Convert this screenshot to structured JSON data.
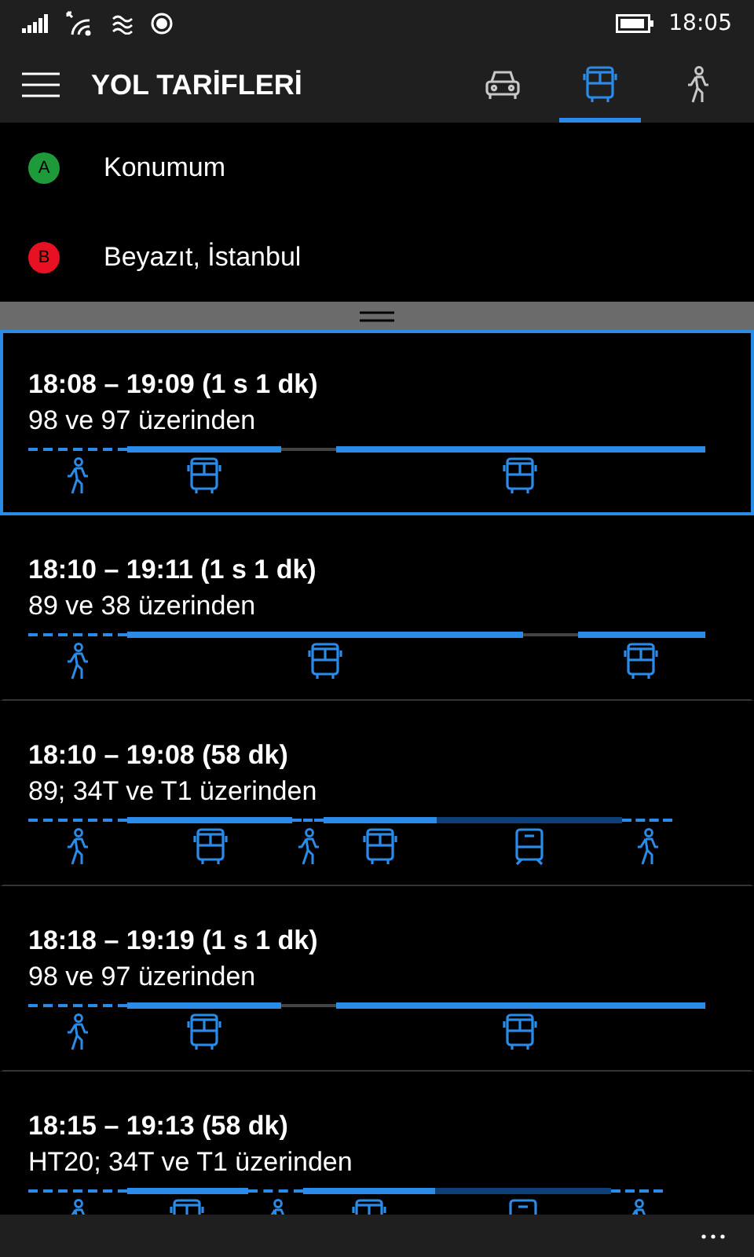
{
  "status_bar": {
    "time": "18:05"
  },
  "header": {
    "title": "YOL TARİFLERİ",
    "modes": [
      {
        "kind": "car",
        "selected": false
      },
      {
        "kind": "bus",
        "selected": true
      },
      {
        "kind": "walk",
        "selected": false
      }
    ]
  },
  "waypoints": [
    {
      "badge": "A",
      "color": "#1f9a3a",
      "label": "Konumum"
    },
    {
      "badge": "B",
      "color": "#e81123",
      "label": "Beyazıt, İstanbul"
    }
  ],
  "routes": [
    {
      "time": "18:08 – 19:09 (1 s 1 dk)",
      "via": "98 ve 97 üzerinden",
      "selected": true,
      "segments": [
        {
          "kind": "walk"
        },
        {
          "kind": "bus"
        },
        {
          "kind": "wait"
        },
        {
          "kind": "bus"
        }
      ]
    },
    {
      "time": "18:10 – 19:11 (1 s 1 dk)",
      "via": "89 ve 38 üzerinden",
      "selected": false,
      "segments": [
        {
          "kind": "walk"
        },
        {
          "kind": "bus"
        },
        {
          "kind": "wait"
        },
        {
          "kind": "bus"
        }
      ]
    },
    {
      "time": "18:10 – 19:08 (58 dk)",
      "via": "89; 34T ve T1 üzerinden",
      "selected": false,
      "segments": [
        {
          "kind": "walk"
        },
        {
          "kind": "bus"
        },
        {
          "kind": "walk"
        },
        {
          "kind": "bus"
        },
        {
          "kind": "tram"
        },
        {
          "kind": "walk"
        }
      ]
    },
    {
      "time": "18:18 – 19:19 (1 s 1 dk)",
      "via": "98 ve 97 üzerinden",
      "selected": false,
      "segments": [
        {
          "kind": "walk"
        },
        {
          "kind": "bus"
        },
        {
          "kind": "wait"
        },
        {
          "kind": "bus"
        }
      ]
    },
    {
      "time": "18:15 – 19:13 (58 dk)",
      "via": "HT20; 34T ve T1 üzerinden",
      "selected": false,
      "segments": [
        {
          "kind": "walk"
        },
        {
          "kind": "bus"
        },
        {
          "kind": "walk"
        },
        {
          "kind": "bus"
        },
        {
          "kind": "tram"
        },
        {
          "kind": "walk"
        }
      ]
    }
  ]
}
